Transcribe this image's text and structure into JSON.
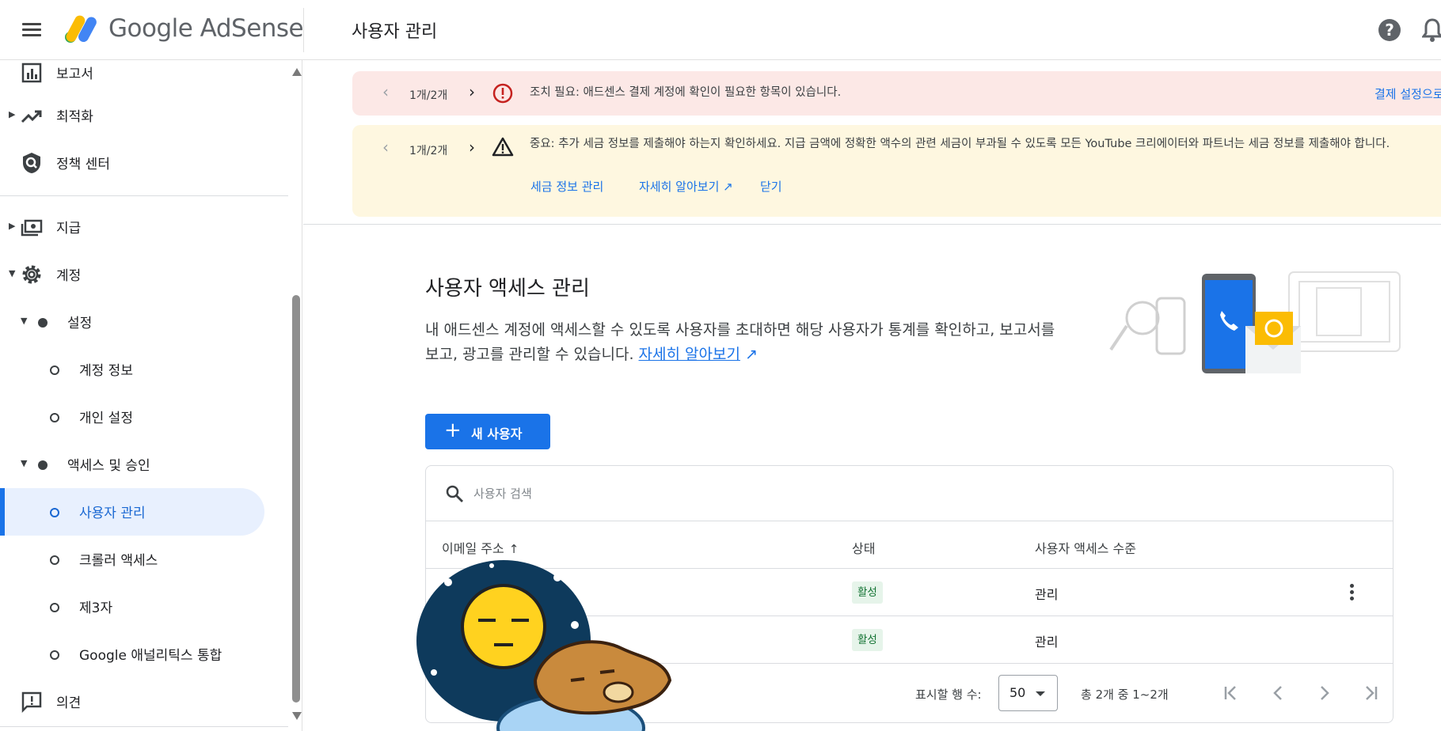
{
  "app": {
    "logo_text": "Google AdSense",
    "page_heading": "사용자 관리"
  },
  "header_icons": {
    "menu": "menu-icon",
    "help": "help-icon",
    "help_symbol": "?",
    "notifications": "bell-icon"
  },
  "sidebar": {
    "items": [
      {
        "label": "보고서",
        "icon": "bar-chart-icon"
      },
      {
        "label": "최적화",
        "icon": "trending-up-icon"
      },
      {
        "label": "정책 센터",
        "icon": "shield-icon"
      },
      {
        "label": "지급",
        "icon": "payments-icon"
      },
      {
        "label": "계정",
        "icon": "gear-icon"
      },
      {
        "label": "설정"
      },
      {
        "label": "계정 정보"
      },
      {
        "label": "개인 설정"
      },
      {
        "label": "액세스 및 승인"
      },
      {
        "label": "사용자 관리",
        "active": true
      },
      {
        "label": "크롤러 액세스"
      },
      {
        "label": "제3자"
      },
      {
        "label": "Google 애널리틱스 통합"
      },
      {
        "label": "의견",
        "icon": "feedback-icon"
      }
    ]
  },
  "banners": {
    "alert": {
      "prev": "‹",
      "counter": "1개/2개",
      "next": "›",
      "message": "조치 필요: 애드센스 결제 계정에 확인이 필요한 항목이 있습니다.",
      "action": "결제 설정으로 이동",
      "icon": "error-icon"
    },
    "notice": {
      "prev": "‹",
      "counter": "1개/2개",
      "next": "›",
      "message": "중요: 추가 세금 정보를 제출해야 하는지 확인하세요. 지급 금액에 정확한 액수의 관련 세금이 부과될 수 있도록 모든 YouTube 크리에이터와 파트너는 세금 정보를 제출해야 합니다.",
      "actions": [
        "세금 정보 관리",
        "자세히 알아보기",
        "닫기"
      ],
      "icon": "warning-icon"
    }
  },
  "content": {
    "title": "사용자 액세스 관리",
    "description": "내 애드센스 계정에 액세스할 수 있도록 사용자를 초대하면 해당 사용자가 통계를 확인하고, 보고서를 보고, 광고를 관리할 수 있습니다.",
    "learn_more": "자세히 알아보기",
    "new_user_plus": "+",
    "new_user_button": "새 사용자"
  },
  "table": {
    "search_placeholder": "사용자 검색",
    "columns": [
      "이메일 주소",
      "상태",
      "사용자 액세스 수준"
    ],
    "sort_indicator": "↑",
    "rows": [
      {
        "email": "",
        "status": "활성",
        "level": "관리"
      },
      {
        "email": "",
        "status": "활성",
        "level": "관리"
      }
    ],
    "rows_per_page_label": "표시할 행 수:",
    "rows_per_page": "50",
    "range": "총 2개 중 1~2개"
  },
  "colors": {
    "accent": "#1a73e8",
    "alert_bg": "#fce8e6",
    "notice_bg": "#fef7e0",
    "status_bg": "#e6f4ea",
    "status_text": "#137333"
  }
}
